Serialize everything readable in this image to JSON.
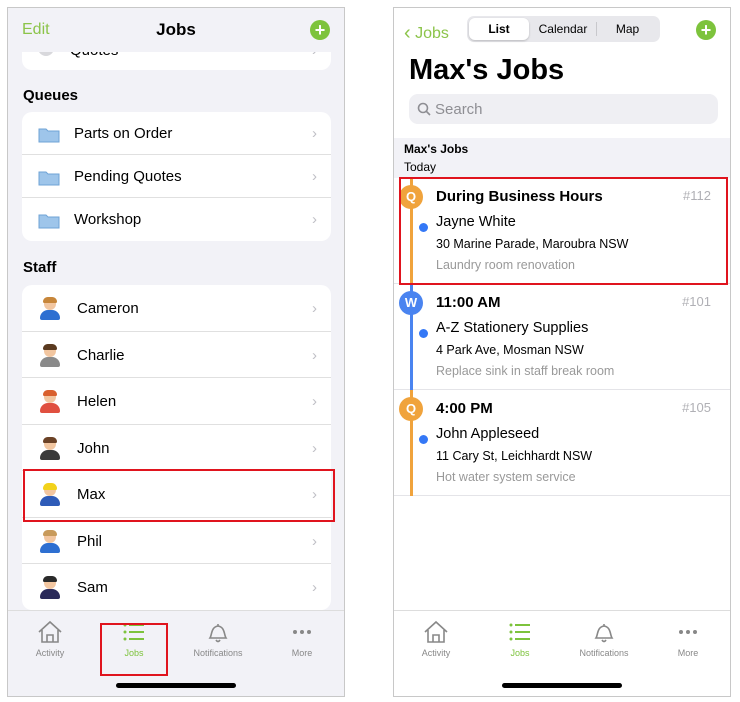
{
  "left": {
    "nav": {
      "edit": "Edit",
      "title": "Jobs"
    },
    "quotes_label": "Quotes",
    "queues_header": "Queues",
    "queues": [
      "Parts on Order",
      "Pending Quotes",
      "Workshop"
    ],
    "staff_header": "Staff",
    "staff": [
      "Cameron",
      "Charlie",
      "Helen",
      "John",
      "Max",
      "Phil",
      "Sam"
    ],
    "tabs": [
      "Activity",
      "Jobs",
      "Notifications",
      "More"
    ],
    "active_tab": "Jobs",
    "accent_color": "#7dc33c"
  },
  "right": {
    "nav": {
      "back": "Jobs",
      "segments": [
        "List",
        "Calendar",
        "Map"
      ],
      "selected_segment": "List"
    },
    "title": "Max's Jobs",
    "search_placeholder": "Search",
    "section": {
      "title": "Max's Jobs",
      "subtitle": "Today"
    },
    "jobs": [
      {
        "badge": "Q",
        "badge_color": "#f0a33c",
        "time": "During Business Hours",
        "number": "#112",
        "client": "Jayne White",
        "address": "30 Marine Parade, Maroubra NSW",
        "description": "Laundry room renovation"
      },
      {
        "badge": "W",
        "badge_color": "#4a84f0",
        "time": "11:00 AM",
        "number": "#101",
        "client": "A-Z Stationery Supplies",
        "address": "4 Park Ave, Mosman NSW",
        "description": "Replace sink in staff break room"
      },
      {
        "badge": "Q",
        "badge_color": "#f0a33c",
        "time": "4:00 PM",
        "number": "#105",
        "client": "John Appleseed",
        "address": "11 Cary St, Leichhardt NSW",
        "description": "Hot water system service"
      }
    ],
    "tabs": [
      "Activity",
      "Jobs",
      "Notifications",
      "More"
    ],
    "active_tab": "Jobs"
  }
}
